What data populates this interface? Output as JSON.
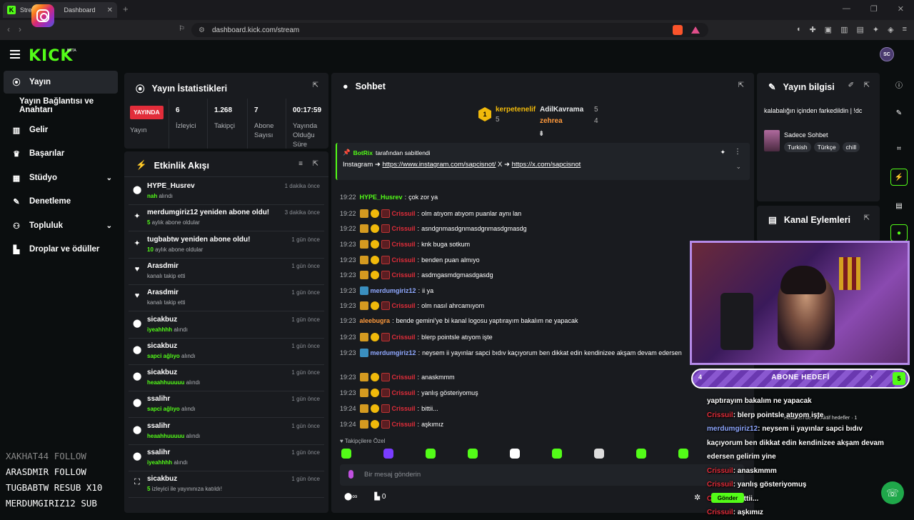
{
  "browser": {
    "tab_title": "Stream Dashboard",
    "tab_title_left": "Strea",
    "tab_title_right": "Dashboard",
    "url": "dashboard.kick.com/stream"
  },
  "header": {
    "logo": "KICK",
    "beta": "BETA",
    "avatar": "SC"
  },
  "sidebar": {
    "items": [
      {
        "label": "Yayın",
        "icon": "broadcast-icon"
      },
      {
        "label": "Yayın Bağlantısı ve Anahtarı",
        "icon": ""
      },
      {
        "label": "Gelir",
        "icon": "chart-icon"
      },
      {
        "label": "Başarılar",
        "icon": "trophy-icon"
      },
      {
        "label": "Stüdyo",
        "icon": "studio-icon"
      },
      {
        "label": "Denetleme",
        "icon": "wrench-icon"
      },
      {
        "label": "Topluluk",
        "icon": "community-icon"
      },
      {
        "label": "Droplar ve ödüller",
        "icon": "gift-icon"
      }
    ]
  },
  "overlay_events": [
    {
      "text": "XAKHAT44  FOLLOW",
      "dim": true
    },
    {
      "text": "ARASDMIR  FOLLOW",
      "dim": false
    },
    {
      "text": "TUGBABTW  RESUB X10",
      "dim": false
    },
    {
      "text": "MERDUMGIRIZ12  SUB",
      "dim": false
    }
  ],
  "stats": {
    "title": "Yayın İstatistikleri",
    "live": "YAYINDA",
    "live_label": "Yayın",
    "viewers": "6",
    "viewers_label": "İzleyici",
    "followers": "1.268",
    "followers_label": "Takipçi",
    "subs": "7",
    "subs_label1": "Abone",
    "subs_label2": "Sayısı",
    "duration": "00:17:59",
    "duration_label1": "Yayında",
    "duration_label2": "Olduğu",
    "duration_label3": "Süre"
  },
  "activity": {
    "title": "Etkinlik Akışı",
    "items": [
      {
        "name": "HYPE_Husrev",
        "hl": "nah",
        "rest": " alındı",
        "time": "1 dakika önce",
        "icon": "points-icon"
      },
      {
        "name": "merdumgiriz12 yeniden abone oldu!",
        "hl": "5",
        "rest": " aylık abone oldular",
        "time": "3 dakika önce",
        "icon": "sparkle-icon"
      },
      {
        "name": "tugbabtw yeniden abone oldu!",
        "hl": "10",
        "rest": " aylık abone oldular",
        "time": "1 gün önce",
        "icon": "sparkle-icon"
      },
      {
        "name": "Arasdmir",
        "hl": "",
        "rest": "kanalı takip etti",
        "time": "1 gün önce",
        "icon": "heart-icon"
      },
      {
        "name": "Arasdmir",
        "hl": "",
        "rest": "kanalı takip etti",
        "time": "1 gün önce",
        "icon": "heart-icon"
      },
      {
        "name": "sicakbuz",
        "hl": "iyeahhhh",
        "rest": " alındı",
        "time": "1 gün önce",
        "icon": "points-icon"
      },
      {
        "name": "sicakbuz",
        "hl": "sapci ağlıyo",
        "rest": " alındı",
        "time": "1 gün önce",
        "icon": "points-icon"
      },
      {
        "name": "sicakbuz",
        "hl": "heaahhuuuuu",
        "rest": " alındı",
        "time": "1 gün önce",
        "icon": "points-icon"
      },
      {
        "name": "ssalihr",
        "hl": "sapci ağlıyo",
        "rest": " alındı",
        "time": "1 gün önce",
        "icon": "points-icon"
      },
      {
        "name": "ssalihr",
        "hl": "heaahhuuuuu",
        "rest": " alındı",
        "time": "1 gün önce",
        "icon": "points-icon"
      },
      {
        "name": "ssalihr",
        "hl": "iyeahhhh",
        "rest": " alındı",
        "time": "1 gün önce",
        "icon": "points-icon"
      },
      {
        "name": "sicakbuz",
        "hl": "5",
        "rest": " izleyici ile yayınınıza katıldı!",
        "time": "1 gün önce",
        "icon": "raid-icon"
      }
    ]
  },
  "chat": {
    "title": "Sohbet",
    "leaders": {
      "first_name": "kerpetenelif",
      "first_count": "5",
      "second_name": "AdilKavrama",
      "second_count": "5",
      "third_name": "zehrea",
      "third_count": "4"
    },
    "pinned": {
      "by": "BotRix",
      "by_suffix": "tarafından sabitlendi",
      "text_prefix": "Instagram ➜ ",
      "link1": "https://www.instagram.com/sapcisnot/",
      "mid": " X ➜ ",
      "link2": "https://x.com/sapcisnot"
    },
    "messages": [
      {
        "time": "19:22",
        "user": "HYPE_Husrev",
        "color": "green",
        "badges": [],
        "text": "çok zor ya"
      },
      {
        "time": "19:22",
        "user": "Crissuil",
        "color": "red",
        "badges": [
          "c",
          "o",
          "r"
        ],
        "text": "olm atıyom atıyom puanlar aynı lan"
      },
      {
        "time": "19:22",
        "user": "Crissuil",
        "color": "red",
        "badges": [
          "c",
          "o",
          "r"
        ],
        "text": "asndgnmasdgnmasdgnmasdgmasdg"
      },
      {
        "time": "19:23",
        "user": "Crissuil",
        "color": "red",
        "badges": [
          "c",
          "o",
          "r"
        ],
        "text": "knk buga sotkum"
      },
      {
        "time": "19:23",
        "user": "Crissuil",
        "color": "red",
        "badges": [
          "c",
          "o",
          "r"
        ],
        "text": "benden puan almıyo"
      },
      {
        "time": "19:23",
        "user": "Crissuil",
        "color": "red",
        "badges": [
          "c",
          "o",
          "r"
        ],
        "text": "asdmgasmdgmasdgasdg"
      },
      {
        "time": "19:23",
        "user": "merdumgiriz12",
        "color": "blue",
        "badges": [
          "g"
        ],
        "text": "ii ya"
      },
      {
        "time": "19:23",
        "user": "Crissuil",
        "color": "red",
        "badges": [
          "c",
          "o",
          "r"
        ],
        "text": "olm nasıl ahrcamıyom"
      },
      {
        "time": "19:23",
        "user": "aleebugra",
        "color": "orange",
        "badges": [],
        "text": "bende gemini'ye bi kanal logosu yaptırayım bakalım ne yapacak"
      },
      {
        "time": "19:23",
        "user": "Crissuil",
        "color": "red",
        "badges": [
          "c",
          "o",
          "r"
        ],
        "text": "blerp pointsle atıyom işte"
      },
      {
        "time": "19:23",
        "user": "merdumgiriz12",
        "color": "blue",
        "badges": [
          "g"
        ],
        "text": "neysem ii yayınlar sapci bıdıv kaçıyorum ben dikkat edin kendinizee akşam devam edersen"
      },
      {
        "time": "19:23",
        "user": "Crissuil",
        "color": "red",
        "badges": [
          "c",
          "o",
          "r"
        ],
        "text": "anaskmmm"
      },
      {
        "time": "19:23",
        "user": "Crissuil",
        "color": "red",
        "badges": [
          "c",
          "o",
          "r"
        ],
        "text": "yanlış gösteriyomuş"
      },
      {
        "time": "19:24",
        "user": "Crissuil",
        "color": "red",
        "badges": [
          "c",
          "o",
          "r"
        ],
        "text": "bittii..."
      },
      {
        "time": "19:24",
        "user": "Crissuil",
        "color": "red",
        "badges": [
          "c",
          "o",
          "r"
        ],
        "text": "aşkımız"
      }
    ],
    "follower_only": "♥ Takipçilere Özel",
    "input_placeholder": "Bir mesaj gönderin",
    "footer_count": "0"
  },
  "info": {
    "title": "Yayın bilgisi",
    "stream_title": "kalabalığın içinden farkedildin | !dc",
    "category": "Sadece Sohbet",
    "tags": [
      "Turkish",
      "Türkçe",
      "chill"
    ]
  },
  "actions": {
    "title": "Kanal Eylemleri"
  },
  "goal": {
    "label": "ABONE HEDEFİ",
    "current": "4",
    "target": "5"
  },
  "overlay_chat": {
    "mini": "Hedefleri be...  ● Aktif hedefler · 1",
    "lines": [
      {
        "user": "",
        "text": "yaptırayım bakalım ne yapacak"
      },
      {
        "user": "Crissuil",
        "text": ": blerp pointsle atıyom işte",
        "c": "r"
      },
      {
        "user": "merdumgiriz12",
        "text": ": neysem ii yayınlar sapci bıdıv",
        "c": "b"
      },
      {
        "user": "",
        "text": "kaçıyorum ben dikkat edin kendinizee akşam devam"
      },
      {
        "user": "",
        "text": "edersen gelirim yine"
      },
      {
        "user": "Crissuil",
        "text": ": anaskmmm",
        "c": "r"
      },
      {
        "user": "Crissuil",
        "text": ": yanlış gösteriyomuş",
        "c": "r"
      },
      {
        "user": "Crissuil",
        "text": ": bittii...",
        "c": "r"
      },
      {
        "user": "Crissuil",
        "text": ": aşkımız",
        "c": "r"
      }
    ],
    "send": "Gönder"
  },
  "colors": {
    "accent": "#53fc18",
    "live": "#e22d3a",
    "panel": "#191b1f"
  }
}
